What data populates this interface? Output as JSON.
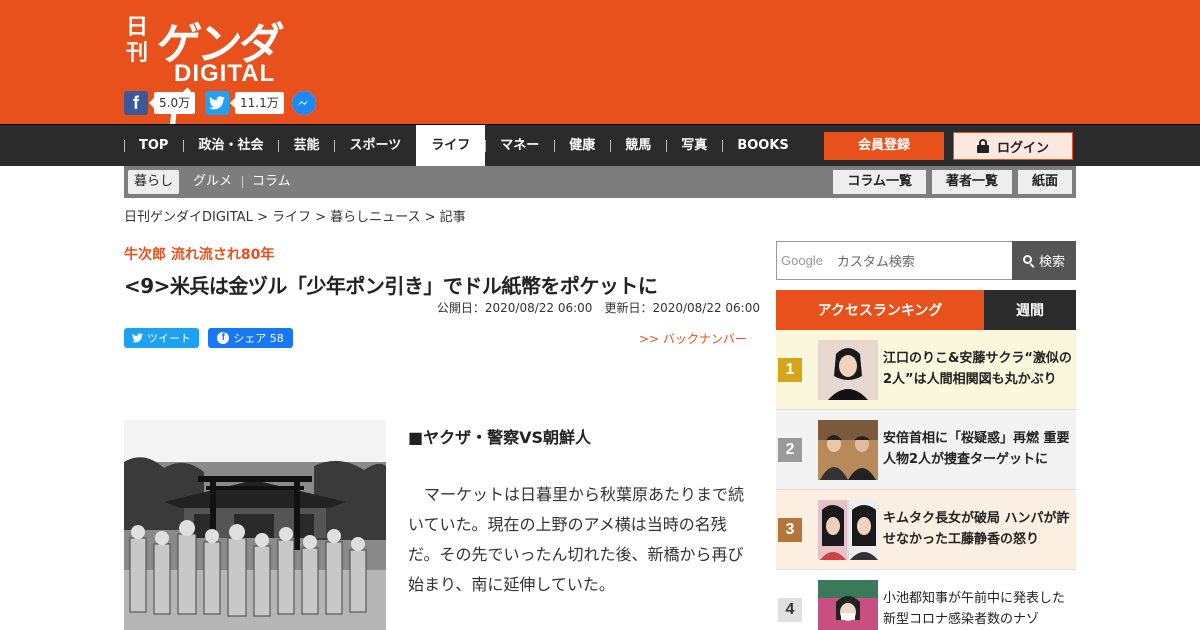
{
  "logo": {
    "nikkan": "日刊",
    "gendai": "ゲンダイ",
    "digital": "DIGITAL"
  },
  "social": [
    {
      "name": "facebook",
      "icon": "facebook-icon",
      "glyph": "f",
      "count": "5.0万"
    },
    {
      "name": "twitter",
      "icon": "twitter-icon",
      "count": "11.1万"
    },
    {
      "name": "messenger",
      "icon": "messenger-icon"
    }
  ],
  "nav": {
    "items": [
      "TOP",
      "政治・社会",
      "芸能",
      "スポーツ",
      "ライフ",
      "マネー",
      "健康",
      "競馬",
      "写真",
      "BOOKS"
    ],
    "active": "ライフ",
    "register": "会員登録",
    "login": "ログイン"
  },
  "subnav": {
    "items": [
      "暮らし",
      "グルメ",
      "コラム"
    ],
    "active": "暮らし",
    "buttons": [
      "コラム一覧",
      "著者一覧",
      "紙面"
    ]
  },
  "breadcrumb": "日刊ゲンダイDIGITAL > ライフ > 暮らしニュース > 記事",
  "article": {
    "series": "牛次郎 流れ流され80年",
    "title": "<9>米兵は金ヅル「少年ポン引き」でドル紙幣をポケットに",
    "published": "公開日：2020/08/22 06:00",
    "updated": "更新日：2020/08/22 06:00",
    "tweet_label": "ツイート",
    "share_label": "シェア 58",
    "backnumber": ">> バックナンバー",
    "subheading": "■ヤクザ・警察VS朝鮮人",
    "body": "　マーケットは日暮里から秋葉原あたりまで続いていた。現在の上野のアメ横は当時の名残だ。その先でいったん切れた後、新橋から再び始まり、南に延伸していた。"
  },
  "search": {
    "brand": "Google",
    "placeholder": "カスタム検索",
    "button": "検索"
  },
  "ranking": {
    "tab_main": "アクセスランキング",
    "tab_week": "週間",
    "items": [
      {
        "rank": "1",
        "text": "江口のりこ&安藤サクラ“激似の2人”は人間相関図も丸かぶり"
      },
      {
        "rank": "2",
        "text": "安倍首相に「桜疑惑」再燃 重要人物2人が捜査ターゲットに"
      },
      {
        "rank": "3",
        "text": "キムタク長女が破局 ハンパが許せなかった工藤静香の怒り"
      },
      {
        "rank": "4",
        "text": "小池都知事が午前中に発表した新型コロナ感染者数のナゾ"
      }
    ]
  },
  "colors": {
    "brand": "#e8501c",
    "nav": "#2b2b2b",
    "subnav": "#7d7d7d"
  }
}
